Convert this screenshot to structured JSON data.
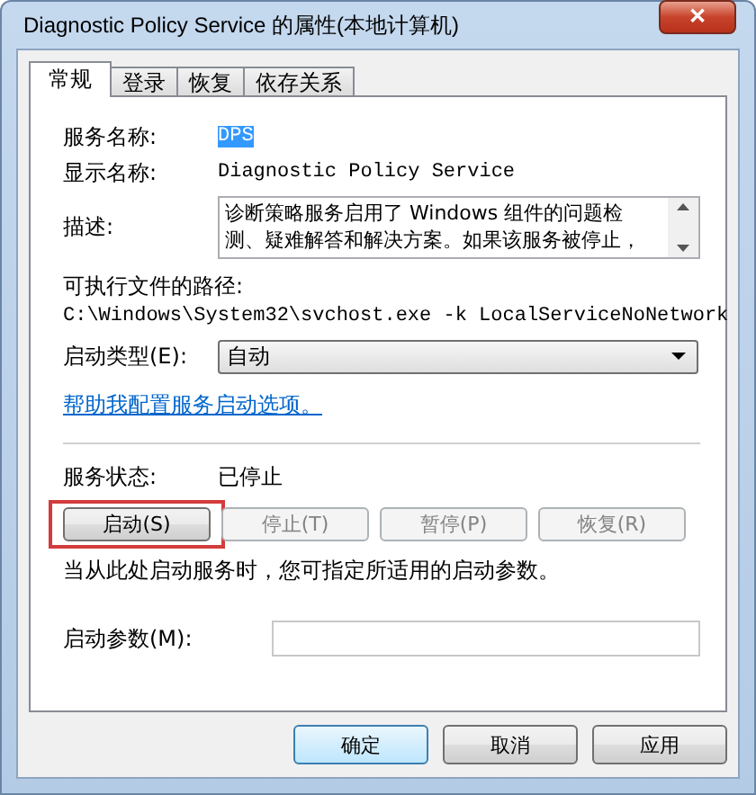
{
  "window": {
    "title": "Diagnostic Policy Service 的属性(本地计算机)",
    "close": "✕"
  },
  "tabs": [
    {
      "label": "常规",
      "selected": true
    },
    {
      "label": "登录",
      "selected": false
    },
    {
      "label": "恢复",
      "selected": false
    },
    {
      "label": "依存关系",
      "selected": false
    }
  ],
  "service_name": {
    "label": "服务名称:",
    "value": "DPS",
    "selected": true
  },
  "display_name": {
    "label": "显示名称:",
    "value": "Diagnostic Policy Service"
  },
  "description": {
    "label": "描述:",
    "value": "诊断策略服务启用了 Windows 组件的问题检测、疑难解答和解决方案。如果该服务被停止，"
  },
  "executable_path": {
    "label": "可执行文件的路径:",
    "value": "C:\\Windows\\System32\\svchost.exe -k LocalServiceNoNetwork"
  },
  "startup_type": {
    "label": "启动类型(E):",
    "value": "自动"
  },
  "help_link": "帮助我配置服务启动选项。",
  "service_status": {
    "label": "服务状态:",
    "value": "已停止"
  },
  "control_buttons": [
    {
      "label": "启动(S)",
      "disabled": false,
      "highlighted": true
    },
    {
      "label": "停止(T)",
      "disabled": true,
      "highlighted": false
    },
    {
      "label": "暂停(P)",
      "disabled": true,
      "highlighted": false
    },
    {
      "label": "恢复(R)",
      "disabled": true,
      "highlighted": false
    }
  ],
  "note": "当从此处启动服务时，您可指定所适用的启动参数。",
  "start_parameters": {
    "label": "启动参数(M):"
  },
  "dialog_buttons": [
    {
      "label": "确定",
      "default": true
    },
    {
      "label": "取消",
      "default": false
    },
    {
      "label": "应用",
      "default": false
    }
  ]
}
